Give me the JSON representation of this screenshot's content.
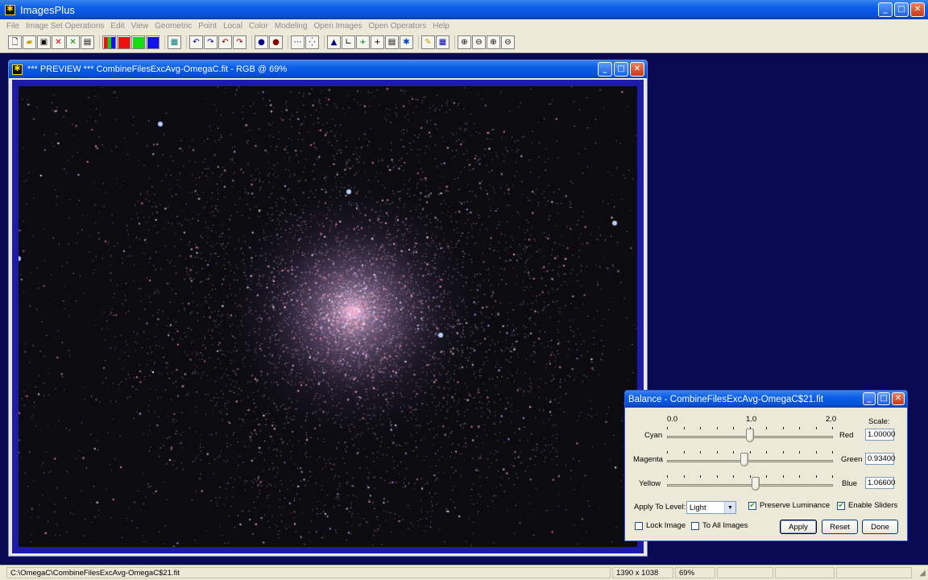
{
  "app": {
    "title": "ImagesPlus"
  },
  "menu": [
    "File",
    "Image Set Operations",
    "Edit",
    "View",
    "Geometric",
    "Point",
    "Local",
    "Color",
    "Modeling",
    "Open Images",
    "Open Operators",
    "Help"
  ],
  "toolbar": {
    "groups": [
      [
        "new-file-icon",
        "open-file-icon",
        "save-icon",
        "close-x-icon",
        "close-all-icon",
        "print-icon"
      ],
      [
        "rgb-channels-icon",
        "red-channel-icon",
        "green-channel-icon",
        "blue-channel-icon"
      ],
      [
        "grid-icon"
      ],
      [
        "undo-icon",
        "redo-icon",
        "undo-all-icon",
        "redo-all-icon"
      ],
      [
        "select-point-icon",
        "select-region-icon"
      ],
      [
        "line-profile-icon",
        "scatter-icon"
      ],
      [
        "histogram-icon",
        "curve-icon",
        "crosshair-add-icon",
        "crosshair-icon",
        "info-box-icon",
        "magic-icon"
      ],
      [
        "pencil-icon",
        "table-icon"
      ],
      [
        "zoom-in-icon",
        "zoom-out-icon",
        "zoom-fit-icon",
        "zoom-actual-icon"
      ]
    ],
    "colors": {
      "red": "#ee1111",
      "green": "#11dd11",
      "blue": "#1111ee"
    }
  },
  "preview": {
    "title": "*** PREVIEW *** CombineFilesExcAvg-OmegaC.fit - RGB @ 69%"
  },
  "balance": {
    "title": "Balance - CombineFilesExcAvg-OmegaC$21.fit",
    "scale_min": "0.0",
    "scale_mid": "1.0",
    "scale_max": "2.0",
    "scale_heading": "Scale:",
    "rows": [
      {
        "left": "Cyan",
        "right": "Red",
        "value": "1.00000",
        "level": 0.5
      },
      {
        "left": "Magenta",
        "right": "Green",
        "value": "0.93400",
        "level": 0.467
      },
      {
        "left": "Yellow",
        "right": "Blue",
        "value": "1.06600",
        "level": 0.533
      }
    ],
    "apply_level_label": "Apply To Level:",
    "apply_level_value": "Light",
    "preserve_luminance": {
      "label": "Preserve Luminance",
      "checked": true
    },
    "enable_sliders": {
      "label": "Enable Sliders",
      "checked": true
    },
    "lock_image": {
      "label": "Lock Image",
      "checked": false
    },
    "to_all_images": {
      "label": "To All Images",
      "checked": false
    },
    "buttons": {
      "apply": "Apply",
      "reset": "Reset",
      "done": "Done"
    }
  },
  "status": {
    "path": "C:\\OmegaC\\CombineFilesExcAvg-OmegaC$21.fit",
    "dimensions": "1390 x 1038",
    "zoom": "69%"
  }
}
